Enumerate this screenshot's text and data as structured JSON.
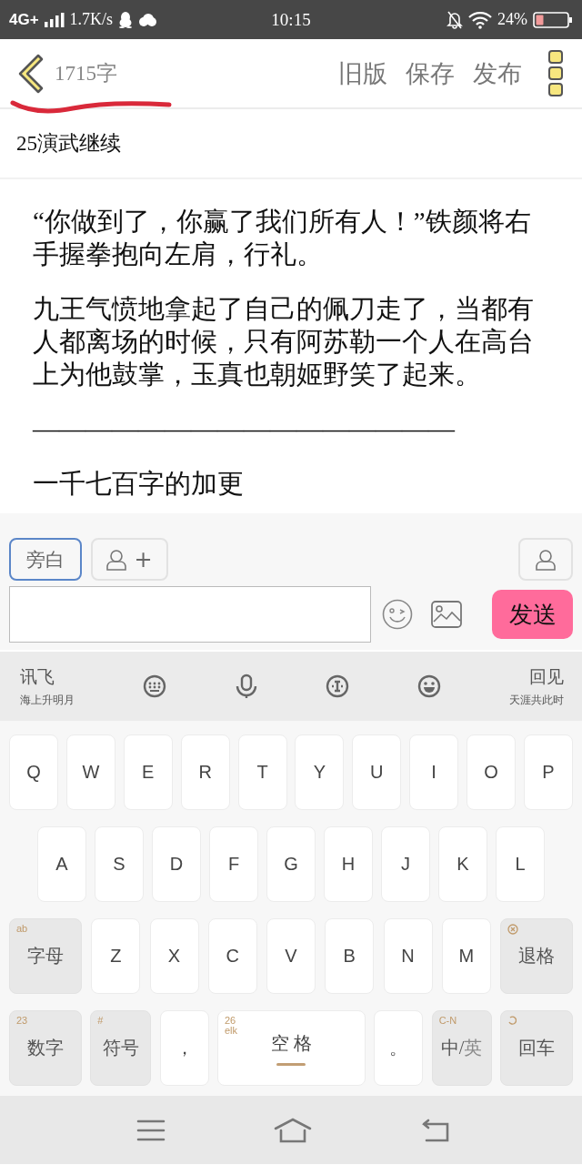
{
  "status_bar": {
    "network": "4G+",
    "speed": "1.7K/s",
    "time": "10:15",
    "battery": "24%"
  },
  "header": {
    "word_count": "1715字",
    "actions": [
      "旧版",
      "保存",
      "发布"
    ]
  },
  "chapter_title": "25演武继续",
  "paragraphs": [
    "“你做到了，你赢了我们所有人！”铁颜将右手握拳抱向左肩，行礼。",
    "九王气愤地拿起了自己的佩刀走了，当都有人都离场的时候，只有阿苏勒一个人在高台上为他鼓掌，玉真也朝姬野笑了起来。",
    "————————————————",
    "一千七百字的加更"
  ],
  "compose": {
    "roles": [
      {
        "kind": "narration",
        "label": "旁白",
        "selected": true
      },
      {
        "kind": "add_role",
        "label": "+",
        "selected": false
      }
    ],
    "send": "发送"
  },
  "ime": {
    "left": {
      "title": "讯飞",
      "subtitle": "海上升明月"
    },
    "right": {
      "title": "回见",
      "subtitle": "天涯共此时"
    }
  },
  "keyboard": {
    "rows": [
      {
        "keys": [
          {
            "kind": "letter",
            "label": "Q"
          },
          {
            "kind": "letter",
            "label": "W"
          },
          {
            "kind": "letter",
            "label": "E"
          },
          {
            "kind": "letter",
            "label": "R"
          },
          {
            "kind": "letter",
            "label": "T"
          },
          {
            "kind": "letter",
            "label": "Y"
          },
          {
            "kind": "letter",
            "label": "U"
          },
          {
            "kind": "letter",
            "label": "I"
          },
          {
            "kind": "letter",
            "label": "O"
          },
          {
            "kind": "letter",
            "label": "P"
          }
        ]
      },
      {
        "keys": [
          {
            "kind": "letter",
            "label": "A"
          },
          {
            "kind": "letter",
            "label": "S"
          },
          {
            "kind": "letter",
            "label": "D"
          },
          {
            "kind": "letter",
            "label": "F"
          },
          {
            "kind": "letter",
            "label": "G"
          },
          {
            "kind": "letter",
            "label": "H"
          },
          {
            "kind": "letter",
            "label": "J"
          },
          {
            "kind": "letter",
            "label": "K"
          },
          {
            "kind": "letter",
            "label": "L"
          }
        ]
      },
      {
        "keys": [
          {
            "kind": "mode",
            "label": "字母",
            "hint": "ab"
          },
          {
            "kind": "letter",
            "label": "Z"
          },
          {
            "kind": "letter",
            "label": "X"
          },
          {
            "kind": "letter",
            "label": "C"
          },
          {
            "kind": "letter",
            "label": "V"
          },
          {
            "kind": "letter",
            "label": "B"
          },
          {
            "kind": "letter",
            "label": "N"
          },
          {
            "kind": "letter",
            "label": "M"
          },
          {
            "kind": "backspace",
            "label": "退格"
          }
        ]
      },
      {
        "keys": [
          {
            "kind": "mode",
            "label": "数字",
            "hint": "23"
          },
          {
            "kind": "symbol",
            "label": "符号",
            "hint": "#"
          },
          {
            "kind": "punct",
            "label": "，"
          },
          {
            "kind": "space",
            "label": "空 格",
            "hint": "26",
            "hint_2": "elk"
          },
          {
            "kind": "punct",
            "label": "。"
          },
          {
            "kind": "lang",
            "label": "中/",
            "label_dim": "英",
            "hint": "C-N"
          },
          {
            "kind": "enter",
            "label": "回车"
          }
        ]
      }
    ]
  }
}
